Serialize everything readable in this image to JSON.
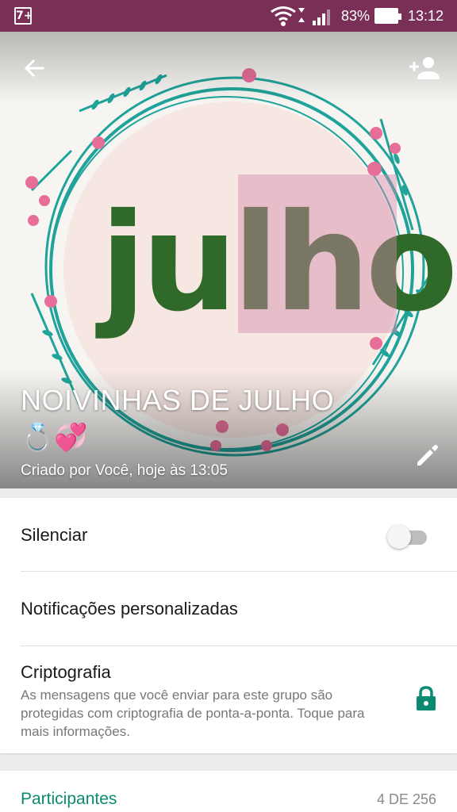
{
  "status_bar": {
    "app_badge": "7+",
    "battery_percent": "83%",
    "time": "13:12"
  },
  "header": {
    "image_text": "julho",
    "group_name": "NOIVINHAS DE JULHO",
    "emoji": "💍💞",
    "created_by": "Criado por Você, hoje às 13:05",
    "icons": {
      "back": "arrow-back-icon",
      "add_participant": "add-person-icon",
      "edit": "pencil-icon"
    }
  },
  "settings": {
    "mute_label": "Silenciar",
    "mute_on": false,
    "custom_notifications_label": "Notificações personalizadas",
    "encryption_label": "Criptografia",
    "encryption_desc": "As mensagens que você enviar para este grupo são protegidas com criptografia de ponta-a-ponta. Toque para mais informações."
  },
  "participants": {
    "label": "Participantes",
    "count": "4 DE 256"
  },
  "colors": {
    "status_bar": "#7a2f57",
    "accent_green": "#0b8a72",
    "wreath_teal": "#1fa39a",
    "blossom_pink": "#e86e9a"
  }
}
